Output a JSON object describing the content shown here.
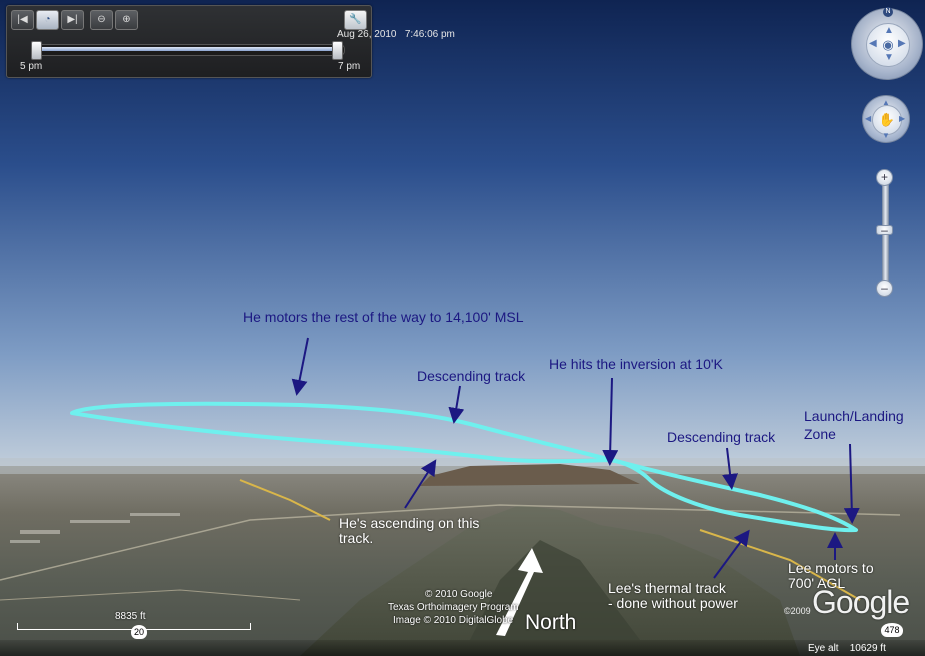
{
  "time_slider": {
    "date": "Aug 26, 2010",
    "time": "7:46:06 pm",
    "start_label": "5 pm",
    "end_label": "7 pm",
    "progress": 1.0,
    "buttons": [
      "back-icon",
      "clock-icon",
      "forward-icon",
      "zoom-out-icon",
      "zoom-in-icon",
      "wrench-icon"
    ]
  },
  "navigation": {
    "compass_label": "N",
    "controls": [
      "look-control",
      "move-control",
      "zoom-slider"
    ]
  },
  "annotations": {
    "motors_rest": "He motors the rest of the way to 14,100' MSL",
    "descending_1": "Descending track",
    "inversion": "He hits the inversion at 10'K",
    "descending_2": "Descending track",
    "launch_line1": "Launch/Landing",
    "launch_line2": "Zone",
    "ascending_line1": "He's ascending on this",
    "ascending_line2": "track.",
    "thermal_line1": "Lee's thermal track",
    "thermal_line2": "- done without power",
    "lee_motors_line1": "Lee motors to",
    "lee_motors_line2": "700' AGL",
    "north": "North"
  },
  "attribution": {
    "line1": "© 2010 Google",
    "line2": "Texas Orthoimagery Program",
    "line3": "Image © 2010 DigitalGlobe",
    "logo": "Google",
    "logo_year": "©2009"
  },
  "scale": {
    "label": "8835 ft",
    "route": "20"
  },
  "status": {
    "route_shield": "478",
    "eye_alt_label": "Eye alt",
    "eye_alt_value": "10629 ft"
  },
  "colors": {
    "sky_top": "#1a3268",
    "sky_horizon": "#aebfd2",
    "track": "#6ff0ee",
    "annotation_text": "#1c1882",
    "arrow": "#1c1882"
  }
}
